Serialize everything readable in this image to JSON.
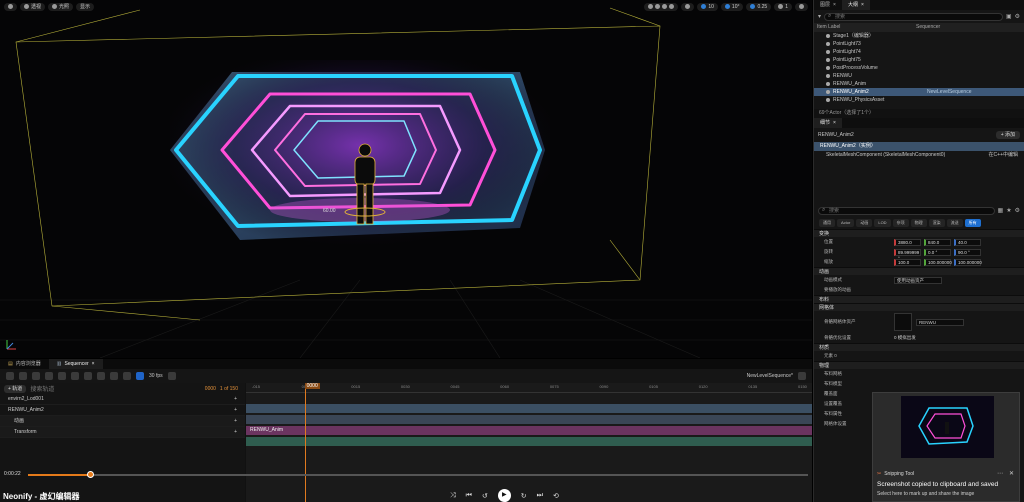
{
  "viewport": {
    "mode_label": "透视",
    "lit_label": "光照",
    "show_label": "显示",
    "grid_snap": "10",
    "rot_snap": "10°",
    "scale_snap": "0.25",
    "camera_speed": "1",
    "distance_label": "60.00"
  },
  "outliner": {
    "tabs": [
      "图层",
      "大纲"
    ],
    "search_placeholder": "搜索",
    "col_label": "Item Label",
    "col_seq": "Sequencer",
    "items": [
      {
        "label": "Stage1（编辑器）",
        "seq": ""
      },
      {
        "label": "PointLight73",
        "seq": ""
      },
      {
        "label": "PointLight74",
        "seq": ""
      },
      {
        "label": "PointLight75",
        "seq": ""
      },
      {
        "label": "PostProcessVolume",
        "seq": ""
      },
      {
        "label": "RENWU",
        "seq": ""
      },
      {
        "label": "RENWU_Anim",
        "seq": ""
      },
      {
        "label": "RENWU_Anim2",
        "seq": "NewLevelSequence"
      },
      {
        "label": "RENWU_PhysicsAsset",
        "seq": ""
      }
    ],
    "footer": "69个Actor（选择了1个）"
  },
  "details": {
    "tab": "细节",
    "actor_name": "RENWU_Anim2",
    "add_label": "+ 添加",
    "root_component": "RENWU_Anim2（实例）",
    "sub_component": "SkeletalMeshComponent (SkeletalMeshComponent0)",
    "sub_component_right": "在C++中编辑",
    "search_placeholder": "搜索",
    "filter_tabs": [
      "通用",
      "Actor",
      "动画",
      "LOD",
      "杂项",
      "物理",
      "渲染",
      "流送",
      "所有"
    ],
    "sections": {
      "transform": "变换",
      "animation": "动画",
      "clothing": "布料",
      "mesh": "网格体",
      "material": "材质",
      "physics": "物理"
    },
    "location": {
      "label": "位置",
      "x": "3880.0",
      "y": "840.0",
      "z": "40.0"
    },
    "rotation": {
      "label": "旋转",
      "x": "89.999999 °",
      "y": "0.0 °",
      "z": "90.0 °"
    },
    "scale": {
      "label": "缩放",
      "x": "100.0",
      "y": "100.000000",
      "z": "100.000000"
    },
    "anim_mode_label": "动画模式",
    "anim_mode_value": "使用动画资产",
    "anim_to_play_label": "要播放的动画",
    "skeletal_mesh_label": "骨骼网格体资产",
    "skeletal_mesh_value": "RENWU",
    "opt_label": "骨骼优化设置",
    "opt_value": "0 模拟出发",
    "element0": "元素 0",
    "rows_extra": [
      "布料网格",
      "布料模型",
      "覆盖面",
      "设置覆盖",
      "布料属性",
      "网格体设置"
    ]
  },
  "sequencer": {
    "tabs": [
      "内容浏览器",
      "Sequencer"
    ],
    "fps": "30 fps",
    "sequence_name": "NewLevelSequence*",
    "add_track": "+ 轨道",
    "search_placeholder": "搜索轨道",
    "current_frame": "0000",
    "frame_total": "1 of 150",
    "playhead_frame": "0000",
    "tracks": [
      {
        "label": "envirn2_Lod001",
        "sub": false
      },
      {
        "label": "RENWU_Anim2",
        "sub": false
      },
      {
        "label": "动画",
        "sub": true
      },
      {
        "label": "Transform",
        "sub": true
      }
    ],
    "clip_label": "RENWU_Anim",
    "ruler_ticks": [
      "-015",
      "0000",
      "0015",
      "0030",
      "0045",
      "0060",
      "0075",
      "0090",
      "0105",
      "0120",
      "0135",
      "0150"
    ]
  },
  "video": {
    "time": "0:00:22",
    "progress": 0.08,
    "caption": "Neonify - 虚幻编辑器"
  },
  "toast": {
    "app": "Snipping Tool",
    "message": "Screenshot copied to clipboard and saved",
    "sub": "Select here to mark up and share the image"
  },
  "colors": {
    "accent_blue": "#1e6fd0",
    "selection": "#3d5878",
    "playhead": "#e07a1f",
    "neon_cyan": "#29d3ff",
    "neon_pink": "#ff4fd8"
  }
}
